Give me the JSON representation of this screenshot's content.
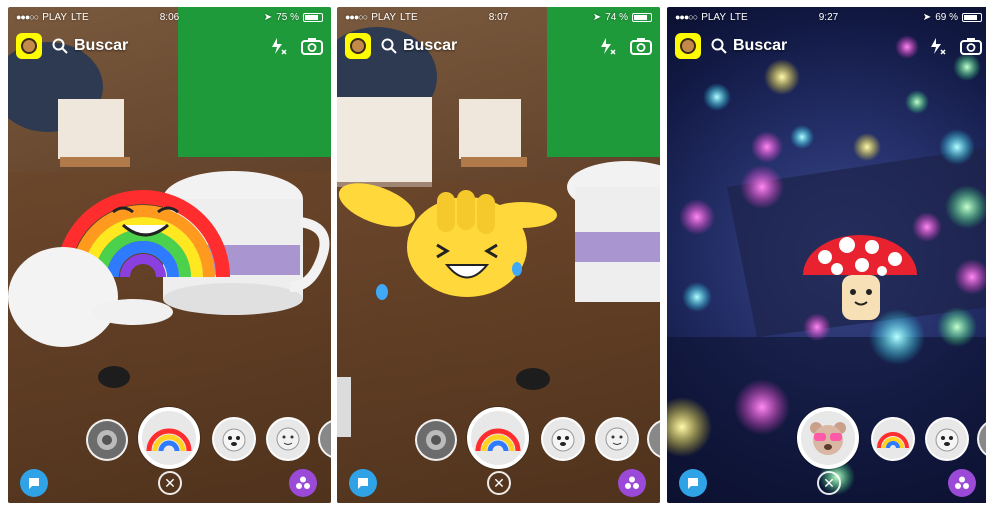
{
  "screens": [
    {
      "status": {
        "signal": "●●●○○",
        "carrier": "PLAY",
        "network": "LTE",
        "time": "8:06",
        "battery": "75 %"
      },
      "search": {
        "label": "Buscar"
      },
      "lenses": [
        "portal",
        "rainbow",
        "dog",
        "face",
        "more"
      ],
      "selected_lens": "rainbow"
    },
    {
      "status": {
        "signal": "●●●○○",
        "carrier": "PLAY",
        "network": "LTE",
        "time": "8:07",
        "battery": "74 %"
      },
      "search": {
        "label": "Buscar"
      },
      "lenses": [
        "portal",
        "rainbow",
        "dog",
        "face",
        "more"
      ],
      "selected_lens": "rainbow"
    },
    {
      "status": {
        "signal": "●●●○○",
        "carrier": "PLAY",
        "network": "LTE",
        "time": "9:27",
        "battery": "69 %"
      },
      "search": {
        "label": "Buscar"
      },
      "lenses": [
        "bear",
        "rainbow",
        "dog",
        "more"
      ],
      "selected_lens": "bear"
    }
  ],
  "colors": {
    "snap_yellow": "#fffc00",
    "chat_blue": "#2fa3e6",
    "stories_purple": "#9a4ad6"
  }
}
